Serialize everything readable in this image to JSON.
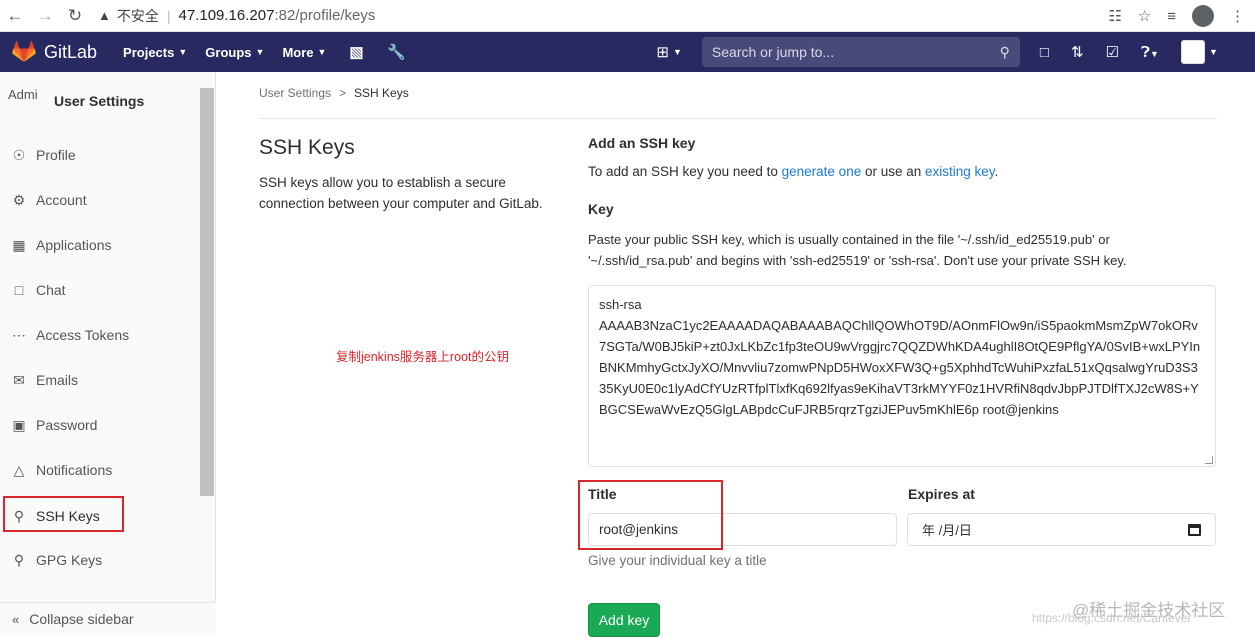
{
  "browser": {
    "back_icon": "back-arrow-icon",
    "forward_icon": "forward-arrow-icon",
    "reload_icon": "reload-icon",
    "security_label": "不安全",
    "url_host": "47.109.16.207",
    "url_path": ":82/profile/keys"
  },
  "header": {
    "logo_text": "GitLab",
    "menu": [
      {
        "label": "Projects"
      },
      {
        "label": "Groups"
      },
      {
        "label": "More"
      }
    ],
    "search_placeholder": "Search or jump to..."
  },
  "sidebar": {
    "avatar_alt": "Admi",
    "title": "User Settings",
    "items": [
      {
        "label": "Profile"
      },
      {
        "label": "Account"
      },
      {
        "label": "Applications"
      },
      {
        "label": "Chat"
      },
      {
        "label": "Access Tokens"
      },
      {
        "label": "Emails"
      },
      {
        "label": "Password"
      },
      {
        "label": "Notifications"
      },
      {
        "label": "SSH Keys"
      },
      {
        "label": "GPG Keys"
      }
    ],
    "collapse_label": "Collapse sidebar"
  },
  "breadcrumb": {
    "parent": "User Settings",
    "separator": ">",
    "current": "SSH Keys"
  },
  "intro": {
    "title": "SSH Keys",
    "description": "SSH keys allow you to establish a secure connection between your computer and GitLab."
  },
  "annotation": "复制jenkins服务器上root的公钥",
  "form": {
    "heading": "Add an SSH key",
    "desc_prefix": "To add an SSH key you need to ",
    "desc_link1": "generate one",
    "desc_middle": " or use an ",
    "desc_link2": "existing key",
    "desc_suffix": ".",
    "key_label": "Key",
    "key_help": "Paste your public SSH key, which is usually contained in the file '~/.ssh/id_ed25519.pub' or '~/.ssh/id_rsa.pub' and begins with 'ssh-ed25519' or 'ssh-rsa'. Don't use your private SSH key.",
    "key_value": "ssh-rsa\nAAAAB3NzaC1yc2EAAAADAQABAAABAQChllQOWhOT9D/AOnmFlOw9n/iS5paokmMsmZpW7okORv7SGTa/W0BJ5kiP+zt0JxLKbZc1fp3teOU9wVrggjrc7QQZDWhKDA4ughlI8OtQE9PflgYA/0SvIB+wxLPYInBNKMmhyGctxJyXO/Mnvvliu7zomwPNpD5HWoxXFW3Q+g5XphhdTcWuhiPxzfaL51xQqsalwgYruD3S335KyU0E0c1lyAdCfYUzRTfplTlxfKq692lfyas9eKihaVT3rkMYYF0z1HVRfiN8qdvJbpPJTDlfTXJ2cW8S+YBGCSEwaWvEzQ5GlgLABpdcCuFJRB5rqrzTgziJEPuv5mKhlE6p root@jenkins",
    "title_label": "Title",
    "title_value": "root@jenkins",
    "title_help": "Give your individual key a title",
    "expires_label": "Expires at",
    "expires_value": "年 /月/日",
    "submit_label": "Add key"
  },
  "watermark": "@稀土掘金技术社区",
  "watermark2": "https://blog.csdn.net/Cantever"
}
